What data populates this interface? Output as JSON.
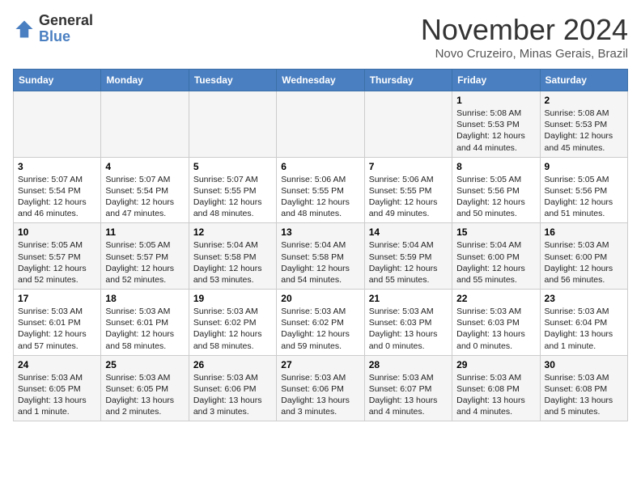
{
  "header": {
    "logo_general": "General",
    "logo_blue": "Blue",
    "month": "November 2024",
    "location": "Novo Cruzeiro, Minas Gerais, Brazil"
  },
  "weekdays": [
    "Sunday",
    "Monday",
    "Tuesday",
    "Wednesday",
    "Thursday",
    "Friday",
    "Saturday"
  ],
  "weeks": [
    [
      {
        "day": "",
        "info": ""
      },
      {
        "day": "",
        "info": ""
      },
      {
        "day": "",
        "info": ""
      },
      {
        "day": "",
        "info": ""
      },
      {
        "day": "",
        "info": ""
      },
      {
        "day": "1",
        "info": "Sunrise: 5:08 AM\nSunset: 5:53 PM\nDaylight: 12 hours\nand 44 minutes."
      },
      {
        "day": "2",
        "info": "Sunrise: 5:08 AM\nSunset: 5:53 PM\nDaylight: 12 hours\nand 45 minutes."
      }
    ],
    [
      {
        "day": "3",
        "info": "Sunrise: 5:07 AM\nSunset: 5:54 PM\nDaylight: 12 hours\nand 46 minutes."
      },
      {
        "day": "4",
        "info": "Sunrise: 5:07 AM\nSunset: 5:54 PM\nDaylight: 12 hours\nand 47 minutes."
      },
      {
        "day": "5",
        "info": "Sunrise: 5:07 AM\nSunset: 5:55 PM\nDaylight: 12 hours\nand 48 minutes."
      },
      {
        "day": "6",
        "info": "Sunrise: 5:06 AM\nSunset: 5:55 PM\nDaylight: 12 hours\nand 48 minutes."
      },
      {
        "day": "7",
        "info": "Sunrise: 5:06 AM\nSunset: 5:55 PM\nDaylight: 12 hours\nand 49 minutes."
      },
      {
        "day": "8",
        "info": "Sunrise: 5:05 AM\nSunset: 5:56 PM\nDaylight: 12 hours\nand 50 minutes."
      },
      {
        "day": "9",
        "info": "Sunrise: 5:05 AM\nSunset: 5:56 PM\nDaylight: 12 hours\nand 51 minutes."
      }
    ],
    [
      {
        "day": "10",
        "info": "Sunrise: 5:05 AM\nSunset: 5:57 PM\nDaylight: 12 hours\nand 52 minutes."
      },
      {
        "day": "11",
        "info": "Sunrise: 5:05 AM\nSunset: 5:57 PM\nDaylight: 12 hours\nand 52 minutes."
      },
      {
        "day": "12",
        "info": "Sunrise: 5:04 AM\nSunset: 5:58 PM\nDaylight: 12 hours\nand 53 minutes."
      },
      {
        "day": "13",
        "info": "Sunrise: 5:04 AM\nSunset: 5:58 PM\nDaylight: 12 hours\nand 54 minutes."
      },
      {
        "day": "14",
        "info": "Sunrise: 5:04 AM\nSunset: 5:59 PM\nDaylight: 12 hours\nand 55 minutes."
      },
      {
        "day": "15",
        "info": "Sunrise: 5:04 AM\nSunset: 6:00 PM\nDaylight: 12 hours\nand 55 minutes."
      },
      {
        "day": "16",
        "info": "Sunrise: 5:03 AM\nSunset: 6:00 PM\nDaylight: 12 hours\nand 56 minutes."
      }
    ],
    [
      {
        "day": "17",
        "info": "Sunrise: 5:03 AM\nSunset: 6:01 PM\nDaylight: 12 hours\nand 57 minutes."
      },
      {
        "day": "18",
        "info": "Sunrise: 5:03 AM\nSunset: 6:01 PM\nDaylight: 12 hours\nand 58 minutes."
      },
      {
        "day": "19",
        "info": "Sunrise: 5:03 AM\nSunset: 6:02 PM\nDaylight: 12 hours\nand 58 minutes."
      },
      {
        "day": "20",
        "info": "Sunrise: 5:03 AM\nSunset: 6:02 PM\nDaylight: 12 hours\nand 59 minutes."
      },
      {
        "day": "21",
        "info": "Sunrise: 5:03 AM\nSunset: 6:03 PM\nDaylight: 13 hours\nand 0 minutes."
      },
      {
        "day": "22",
        "info": "Sunrise: 5:03 AM\nSunset: 6:03 PM\nDaylight: 13 hours\nand 0 minutes."
      },
      {
        "day": "23",
        "info": "Sunrise: 5:03 AM\nSunset: 6:04 PM\nDaylight: 13 hours\nand 1 minute."
      }
    ],
    [
      {
        "day": "24",
        "info": "Sunrise: 5:03 AM\nSunset: 6:05 PM\nDaylight: 13 hours\nand 1 minute."
      },
      {
        "day": "25",
        "info": "Sunrise: 5:03 AM\nSunset: 6:05 PM\nDaylight: 13 hours\nand 2 minutes."
      },
      {
        "day": "26",
        "info": "Sunrise: 5:03 AM\nSunset: 6:06 PM\nDaylight: 13 hours\nand 3 minutes."
      },
      {
        "day": "27",
        "info": "Sunrise: 5:03 AM\nSunset: 6:06 PM\nDaylight: 13 hours\nand 3 minutes."
      },
      {
        "day": "28",
        "info": "Sunrise: 5:03 AM\nSunset: 6:07 PM\nDaylight: 13 hours\nand 4 minutes."
      },
      {
        "day": "29",
        "info": "Sunrise: 5:03 AM\nSunset: 6:08 PM\nDaylight: 13 hours\nand 4 minutes."
      },
      {
        "day": "30",
        "info": "Sunrise: 5:03 AM\nSunset: 6:08 PM\nDaylight: 13 hours\nand 5 minutes."
      }
    ]
  ]
}
